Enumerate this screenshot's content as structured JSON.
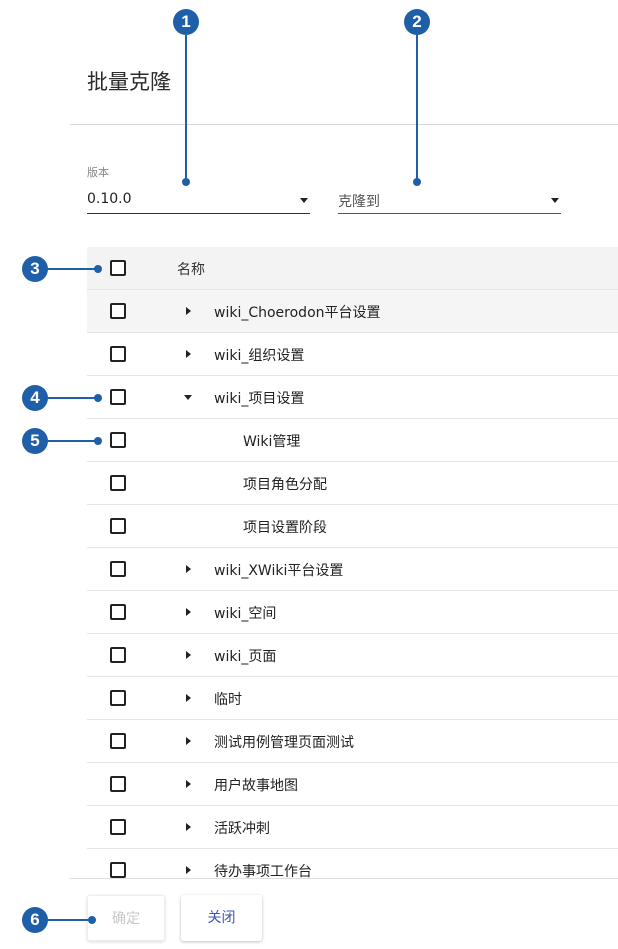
{
  "dialog": {
    "title": "批量克隆",
    "version_label": "版本",
    "version_value": "0.10.0",
    "target_placeholder": "克隆到"
  },
  "table": {
    "header": "名称",
    "rows": [
      {
        "label": "wiki_Choerodon平台设置"
      },
      {
        "label": "wiki_组织设置"
      },
      {
        "label": "wiki_项目设置"
      },
      {
        "label": "Wiki管理"
      },
      {
        "label": "项目角色分配"
      },
      {
        "label": "项目设置阶段"
      },
      {
        "label": "wiki_XWiki平台设置"
      },
      {
        "label": "wiki_空间"
      },
      {
        "label": "wiki_页面"
      },
      {
        "label": "临时"
      },
      {
        "label": "测试用例管理页面测试"
      },
      {
        "label": "用户故事地图"
      },
      {
        "label": "活跃冲刺"
      },
      {
        "label": "待办事项工作台"
      }
    ]
  },
  "footer": {
    "confirm_label": "确定",
    "close_label": "关闭"
  },
  "markers": [
    "1",
    "2",
    "3",
    "4",
    "5",
    "6"
  ],
  "colors": {
    "marker": "#1f5fa8",
    "primary": "#3f51b5"
  }
}
